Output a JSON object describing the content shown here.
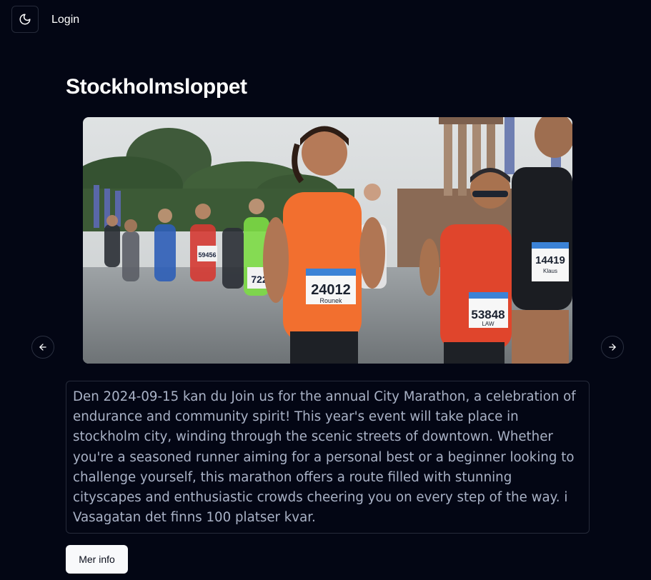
{
  "header": {
    "theme_toggle_icon": "moon-icon",
    "login_label": "Login"
  },
  "event": {
    "title": "Stockholmsloppet",
    "image_alt": "Marathon runners",
    "description": "Den 2024-09-15 kan du Join us for the annual City Marathon, a celebration of endurance and community spirit! This year's event will take place in stockholm city, winding through the scenic streets of downtown. Whether you're a seasoned runner aiming for a personal best or a beginner looking to challenge yourself, this marathon offers a route filled with stunning cityscapes and enthusiastic crowds cheering you on every step of the way. i Vasagatan det finns 100 platser kvar.",
    "more_info_label": "Mer info"
  },
  "carousel": {
    "prev_icon": "arrow-left-icon",
    "next_icon": "arrow-right-icon",
    "bib_numbers": [
      "24012",
      "53848",
      "14419",
      "59456",
      "722"
    ],
    "bib_names": [
      "Rounek",
      "LAW",
      "Klaus"
    ]
  },
  "colors": {
    "background": "#030614",
    "border": "#262b3a",
    "text_muted": "#a9b2c6",
    "button_bg": "#f8f9fb"
  }
}
